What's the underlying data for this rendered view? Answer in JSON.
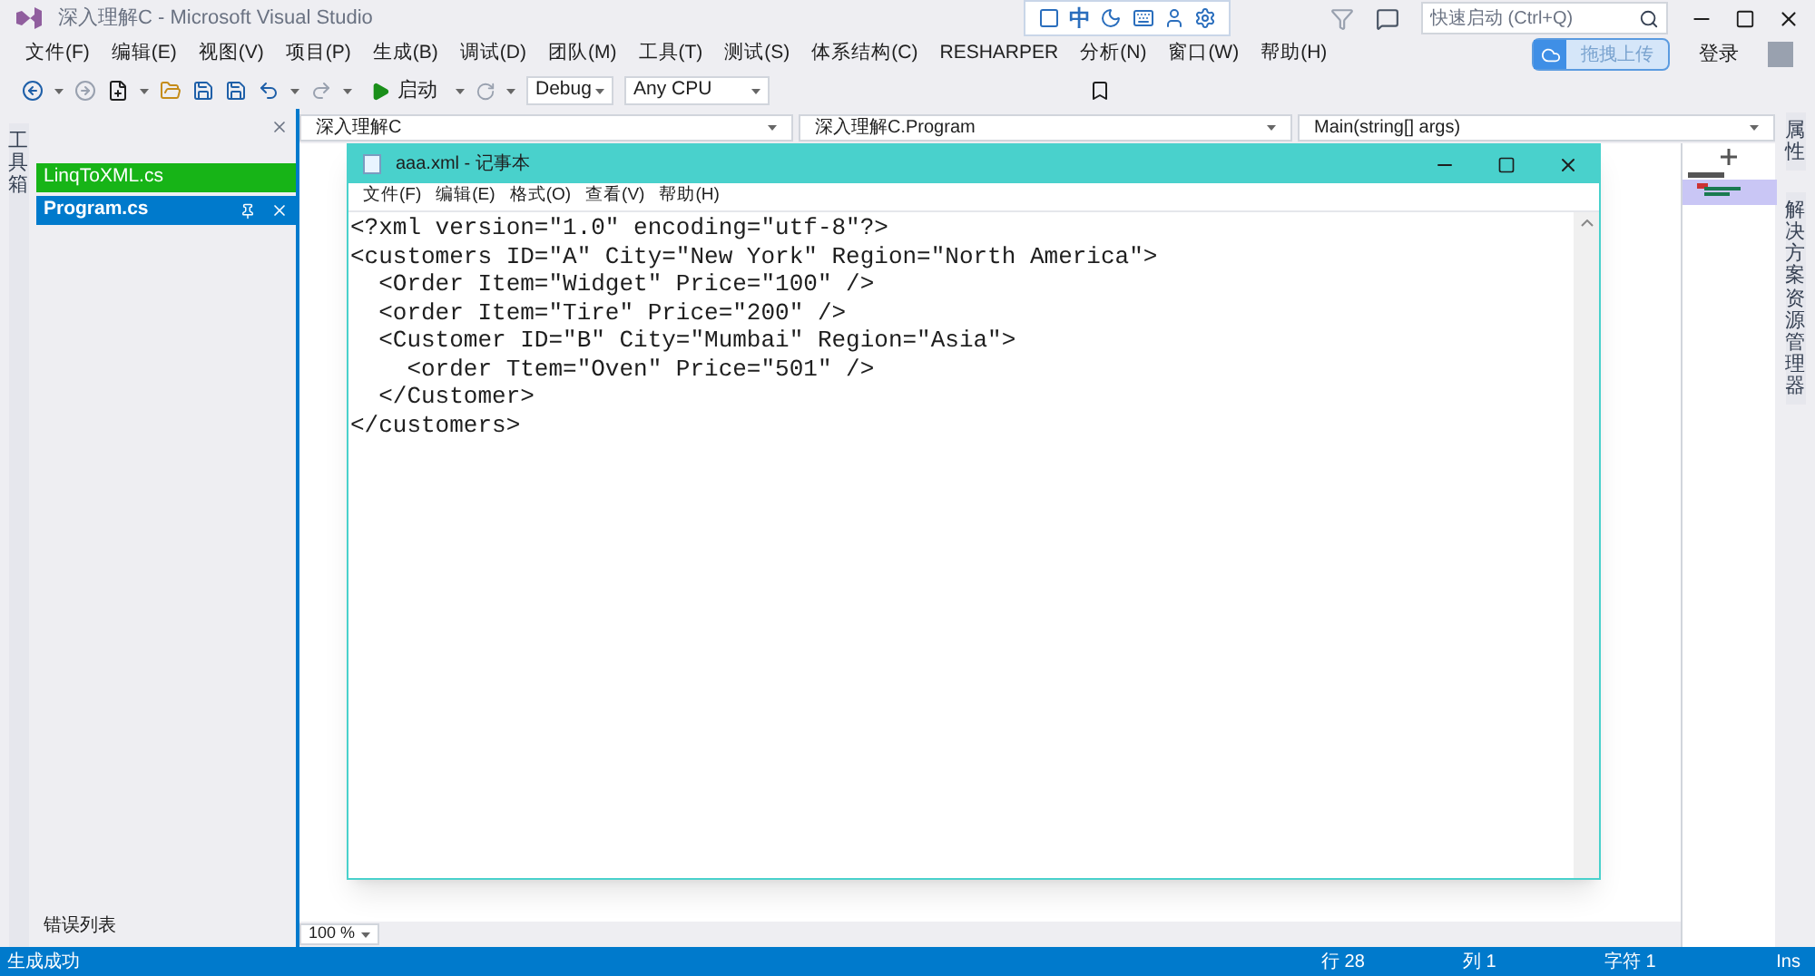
{
  "window": {
    "title": "深入理解C - Microsoft Visual Studio"
  },
  "ime_toolbar": {
    "mode": "中"
  },
  "quick_launch": {
    "placeholder": "快速启动 (Ctrl+Q)"
  },
  "menu": [
    "文件(F)",
    "编辑(E)",
    "视图(V)",
    "项目(P)",
    "生成(B)",
    "调试(D)",
    "团队(M)",
    "工具(T)",
    "测试(S)",
    "体系结构(C)",
    "RESHARPER",
    "分析(N)",
    "窗口(W)",
    "帮助(H)"
  ],
  "upload_button": "拖拽上传",
  "sign_in": "登录",
  "toolbar": {
    "start": "启动",
    "configuration": "Debug",
    "platform": "Any CPU"
  },
  "toolbox_tab": "工具箱",
  "open_files": [
    {
      "label": "LinqToXML.cs",
      "selected": false,
      "color": "#17b417"
    },
    {
      "label": "Program.cs",
      "selected": true,
      "color": "#007acc"
    }
  ],
  "nav_bar": [
    "深入理解C",
    "深入理解C.Program",
    "Main(string[] args)"
  ],
  "zoom": "100 %",
  "right_tabs": [
    "属性",
    "解决方案资源管理器"
  ],
  "bottom_tab": "错误列表",
  "status_bar": {
    "message": "生成成功",
    "items": [
      "行 28",
      "列 1",
      "字符 1",
      "Ins"
    ]
  },
  "notepad": {
    "title": "aaa.xml - 记事本",
    "menu": [
      "文件(F)",
      "编辑(E)",
      "格式(O)",
      "查看(V)",
      "帮助(H)"
    ],
    "lines": [
      "<?xml version=\"1.0\" encoding=\"utf-8\"?>",
      "<customers ID=\"A\" City=\"New York\" Region=\"North America\">",
      "  <Order Item=\"Widget\" Price=\"100\" />",
      "  <order Item=\"Tire\" Price=\"200\" />",
      "  <Customer ID=\"B\" City=\"Mumbai\" Region=\"Asia\">",
      "    <order Ttem=\"Oven\" Price=\"501\" />",
      "  </Customer>",
      "</customers>"
    ]
  }
}
